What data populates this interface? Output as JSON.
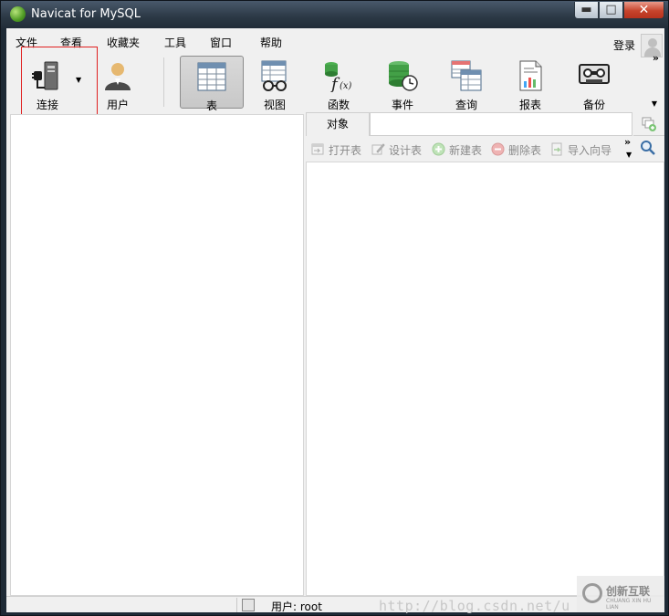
{
  "window": {
    "title": "Navicat for MySQL"
  },
  "menu": {
    "items": [
      "文件",
      "查看",
      "收藏夹",
      "工具",
      "窗口",
      "帮助"
    ],
    "login": "登录"
  },
  "toolbar": {
    "connect": "连接",
    "user": "用户",
    "table": "表",
    "view": "视图",
    "function": "函数",
    "event": "事件",
    "query": "查询",
    "report": "报表",
    "backup": "备份"
  },
  "object_tab": {
    "label": "对象"
  },
  "object_toolbar": {
    "open_table": "打开表",
    "design_table": "设计表",
    "new_table": "新建表",
    "delete_table": "删除表",
    "import_wizard": "导入向导"
  },
  "status": {
    "user": "用户: root"
  },
  "watermark": {
    "url": "http://blog.csdn.net/u"
  },
  "colors": {
    "highlight": "#e02020",
    "title_bar": "#2b3845"
  }
}
